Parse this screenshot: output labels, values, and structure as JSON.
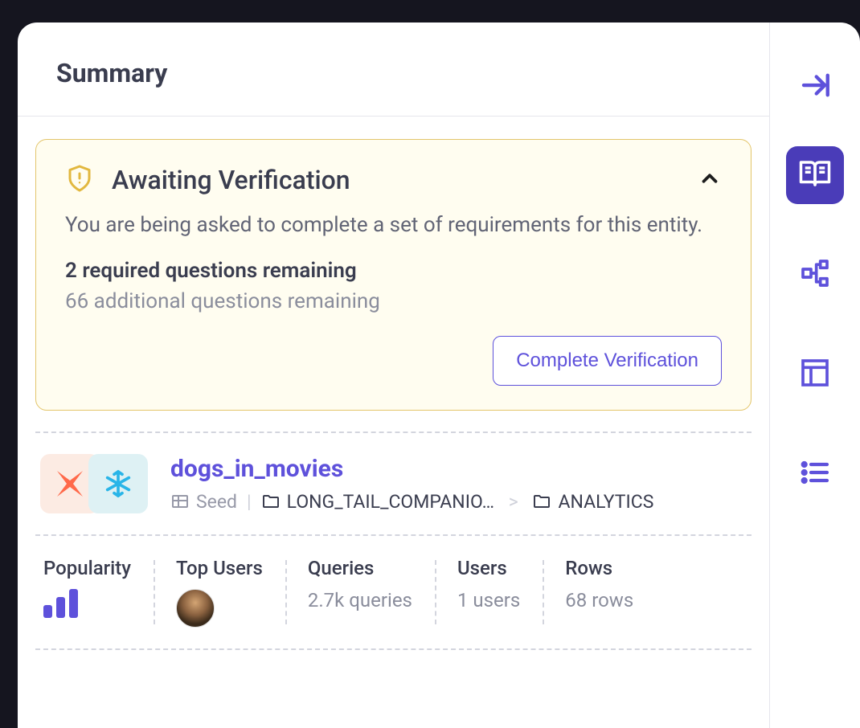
{
  "header": {
    "title": "Summary"
  },
  "verification": {
    "title": "Awaiting Verification",
    "description": "You are being asked to complete a set of requirements for this entity.",
    "required_remaining": "2 required questions remaining",
    "additional_remaining": "66 additional questions remaining",
    "button_label": "Complete Verification"
  },
  "entity": {
    "name": "dogs_in_movies",
    "type": "Seed",
    "path1": "LONG_TAIL_COMPANIO…",
    "path2": "ANALYTICS"
  },
  "stats": {
    "popularity_label": "Popularity",
    "top_users_label": "Top Users",
    "queries_label": "Queries",
    "queries_value": "2.7k queries",
    "users_label": "Users",
    "users_value": "1 users",
    "rows_label": "Rows",
    "rows_value": "68 rows"
  }
}
